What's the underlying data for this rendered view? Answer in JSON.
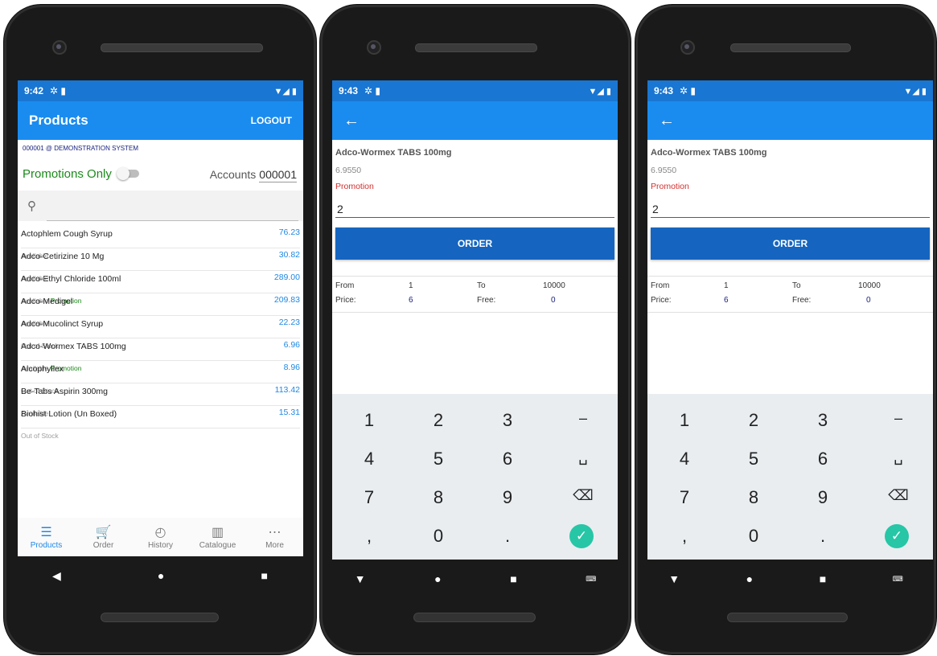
{
  "screen1": {
    "status_time": "9:42",
    "title": "Products",
    "logout": "LOGOUT",
    "account_line": "000001 @ DEMONSTRATION SYSTEM",
    "promotions_only": "Promotions Only",
    "accounts_label": "Accounts",
    "accounts_value": "000001",
    "products": [
      {
        "name": "Actophlem Cough Syrup",
        "price": "76.23",
        "status": "Available",
        "promo": ""
      },
      {
        "name": "Adco-Cetirizine 10 Mg",
        "price": "30.82",
        "status": "Available",
        "promo": ""
      },
      {
        "name": "Adco-Ethyl Chloride 100ml",
        "price": "289.00",
        "status": "Available",
        "promo": "Promotion"
      },
      {
        "name": "Adco-Medigel",
        "price": "209.83",
        "status": "Available",
        "promo": ""
      },
      {
        "name": "Adco-Mucolinct Syrup",
        "price": "22.23",
        "status": "Out of Stock",
        "promo": ""
      },
      {
        "name": "Adco-Wormex TABS 100mg",
        "price": "6.96",
        "status": "Available",
        "promo": "Promotion"
      },
      {
        "name": "Alcophyllex",
        "price": "8.96",
        "status": "Out of Stock",
        "promo": ""
      },
      {
        "name": "Be-Tabs Aspirin 300mg",
        "price": "113.42",
        "status": "Available",
        "promo": ""
      },
      {
        "name": "Biohist Lotion  (Un Boxed)",
        "price": "15.31",
        "status": "Out of Stock",
        "promo": ""
      }
    ],
    "bottom_nav": [
      {
        "label": "Products",
        "icon": "list-icon",
        "glyph": "☰"
      },
      {
        "label": "Order",
        "icon": "cart-icon",
        "glyph": "🛒"
      },
      {
        "label": "History",
        "icon": "clock-icon",
        "glyph": "◴"
      },
      {
        "label": "Catalogue",
        "icon": "book-icon",
        "glyph": "▥"
      },
      {
        "label": "More",
        "icon": "more-icon",
        "glyph": "⋯"
      }
    ]
  },
  "screen2": {
    "status_time": "9:43",
    "product_name": "Adco-Wormex TABS 100mg",
    "price": "6.9550",
    "promotion": "Promotion",
    "quantity": "2",
    "order_button": "ORDER",
    "tier": {
      "from_label": "From",
      "from": "1",
      "to_label": "To",
      "to": "10000",
      "price_label": "Price:",
      "price": "6",
      "free_label": "Free:",
      "free": "0"
    }
  },
  "screen3": {
    "status_time": "9:43",
    "product_name": "Adco-Wormex TABS 100mg",
    "price": "6.9550",
    "promotion": "Promotion",
    "quantity": "2",
    "order_button": "ORDER",
    "tier": {
      "from_label": "From",
      "from": "1",
      "to_label": "To",
      "to": "10000",
      "price_label": "Price:",
      "price": "6",
      "free_label": "Free:",
      "free": "0"
    }
  },
  "keypad": {
    "keys": [
      "1",
      "2",
      "3",
      "–",
      "4",
      "5",
      "6",
      "␣",
      "7",
      "8",
      "9",
      "⌫",
      ",",
      "0",
      "."
    ]
  },
  "colors": {
    "statusbar": "#1976d2",
    "appbar": "#1a8cf0",
    "order_button": "#1565c0",
    "accent": "#d81b60"
  }
}
